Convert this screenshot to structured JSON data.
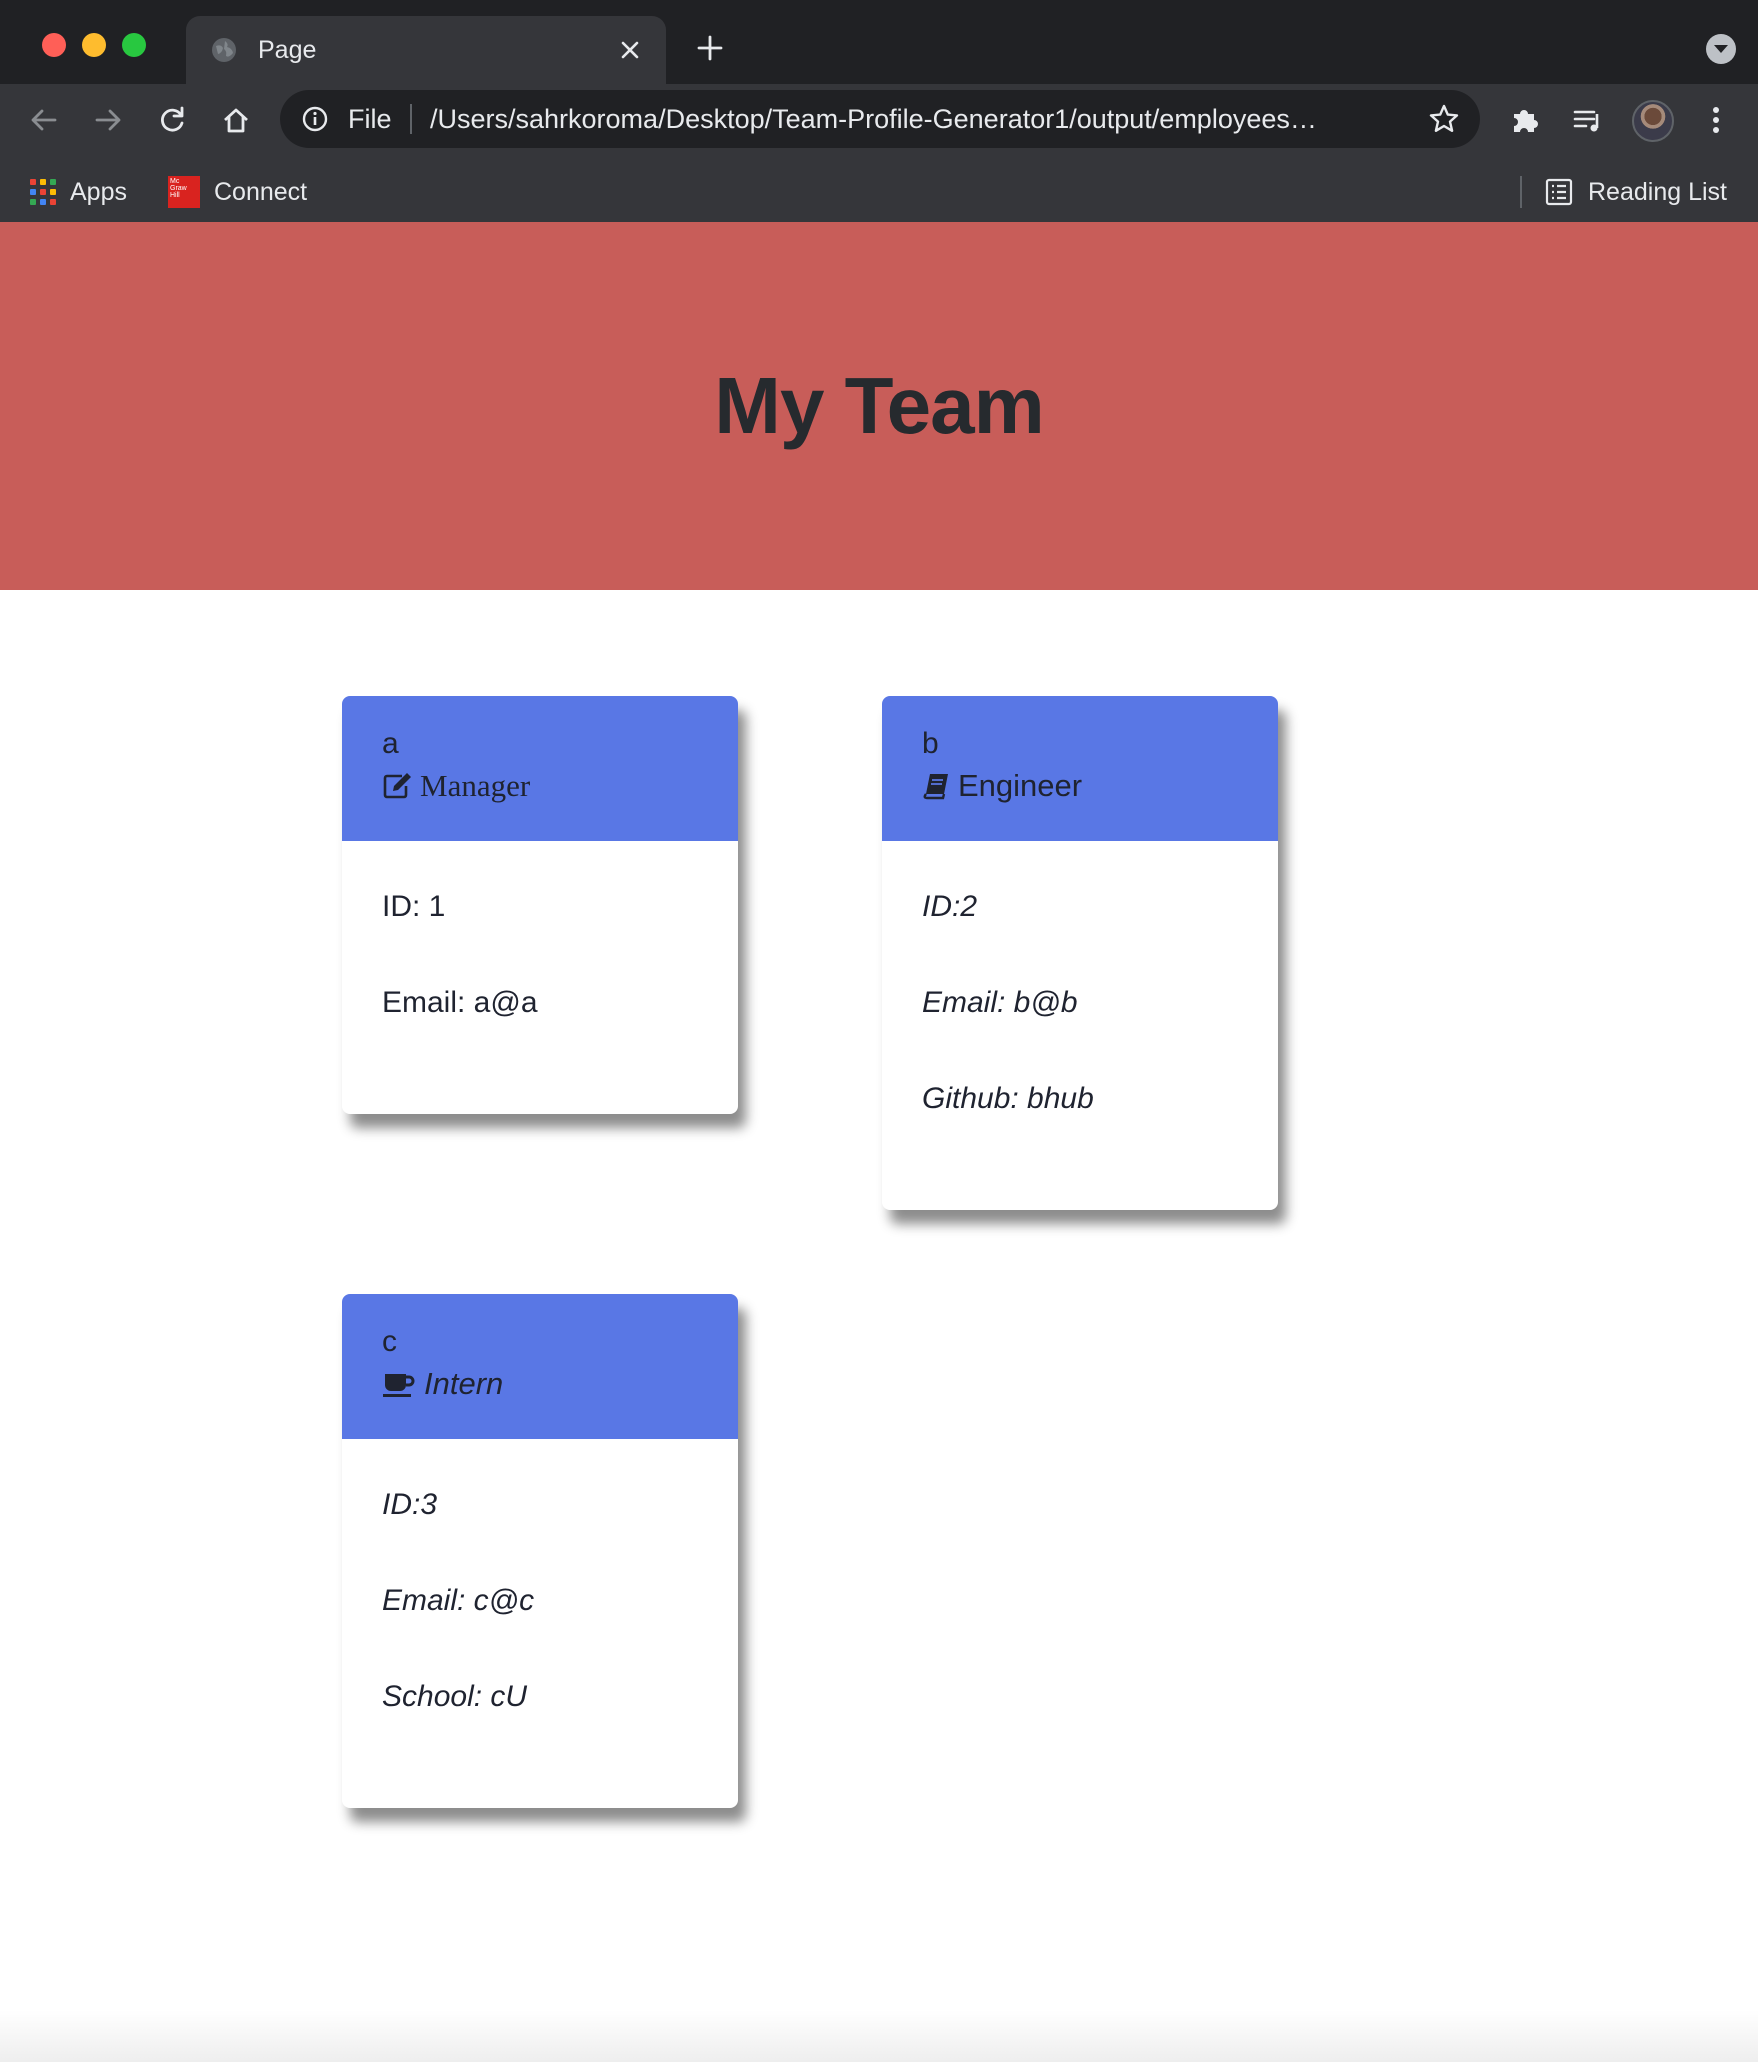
{
  "browser": {
    "tab_title": "Page",
    "omnibox_scheme": "File",
    "url": "/Users/sahrkoroma/Desktop/Team-Profile-Generator1/output/employees…",
    "bookmarks": [
      {
        "label": "Apps",
        "icon": "apps-grid-icon"
      },
      {
        "label": "Connect",
        "icon": "mcgraw-hill-logo"
      }
    ],
    "reading_list": "Reading List",
    "colors": {
      "frame": "#202124",
      "toolbar": "#35363a"
    }
  },
  "page": {
    "title": "My Team",
    "header_color": "#c85d59",
    "card_header_color": "#5977e5"
  },
  "team": [
    {
      "name": "a",
      "role": "Manager",
      "role_icon": "edit-icon",
      "lines": [
        "ID: 1",
        "Email: a@a"
      ]
    },
    {
      "name": "b",
      "role": "Engineer",
      "role_icon": "book-icon",
      "lines": [
        "ID:2",
        "Email: b@b",
        "Github: bhub"
      ]
    },
    {
      "name": "c",
      "role": "Intern",
      "role_icon": "coffee-cup-icon",
      "lines": [
        "ID:3",
        "Email: c@c",
        "School: cU"
      ]
    }
  ]
}
